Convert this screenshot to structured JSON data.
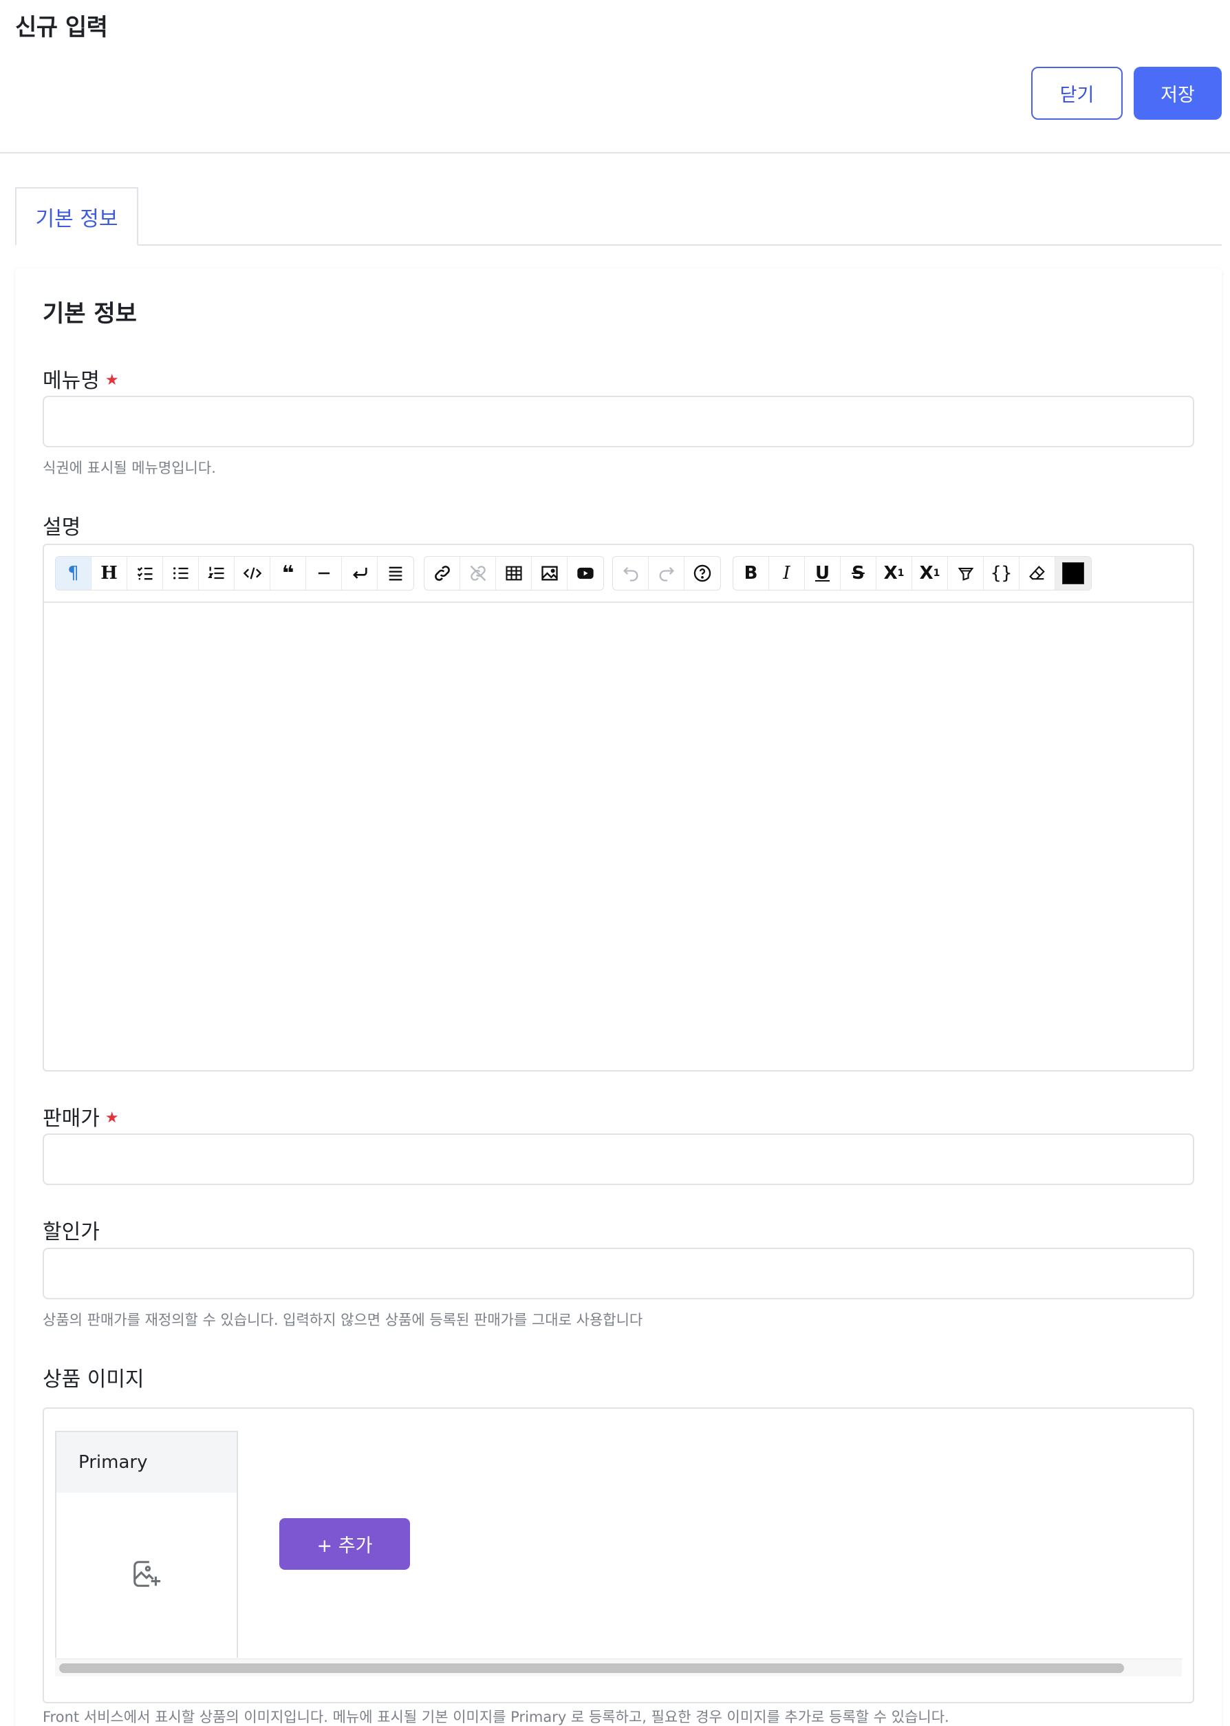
{
  "page": {
    "title": "신규 입력"
  },
  "actions": {
    "close_label": "닫기",
    "save_label": "저장"
  },
  "tabs": [
    {
      "label": "기본 정보",
      "active": true
    }
  ],
  "section": {
    "title": "기본 정보"
  },
  "fields": {
    "menu_name": {
      "label": "메뉴명",
      "required": "★",
      "value": "",
      "help": "식권에 표시될 메뉴명입니다."
    },
    "description": {
      "label": "설명"
    },
    "price": {
      "label": "판매가",
      "required": "★",
      "value": ""
    },
    "discount_price": {
      "label": "할인가",
      "value": "",
      "help": "상품의 판매가를 재정의할 수 있습니다. 입력하지 않으면 상품에 등록된 판매가를 그대로 사용합니다"
    },
    "product_image": {
      "label": "상품 이미지",
      "card_title": "Primary",
      "add_label": "+ 추가",
      "help": "Front 서비스에서 표시할 상품의 이미지입니다. 메뉴에 표시될 기본 이미지를 Primary 로 등록하고, 필요한 경우 이미지를 추가로 등록할 수 있습니다."
    }
  },
  "editor_toolbar": {
    "groups": [
      [
        "paragraph-icon",
        "heading-icon",
        "task-list-icon",
        "bullet-list-icon",
        "ordered-list-icon",
        "code-block-icon",
        "blockquote-icon",
        "horizontal-rule-icon",
        "hard-break-icon",
        "align-icon"
      ],
      [
        "link-icon",
        "unlink-icon",
        "table-icon",
        "image-icon",
        "youtube-icon"
      ],
      [
        "undo-icon",
        "redo-icon",
        "help-icon"
      ],
      [
        "bold-icon",
        "italic-icon",
        "underline-icon",
        "strikethrough-icon",
        "superscript-icon",
        "subscript-icon",
        "highlight-icon",
        "code-icon",
        "eraser-icon",
        "text-color-swatch"
      ]
    ],
    "text_color": "#000000"
  },
  "colors": {
    "primary": "#4a6cf7",
    "add_button": "#7d57d1",
    "required": "#e5333c"
  }
}
